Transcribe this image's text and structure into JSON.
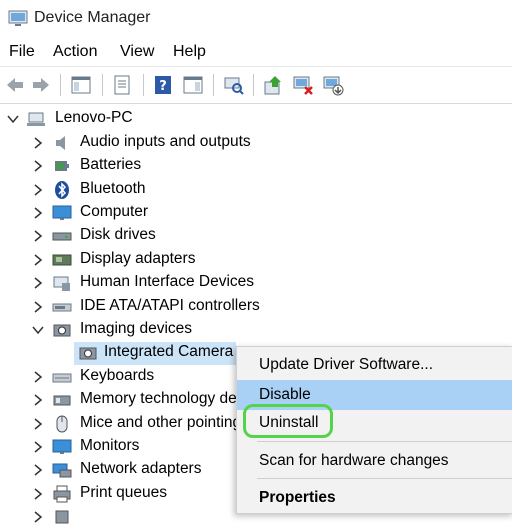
{
  "window": {
    "title": "Device Manager"
  },
  "menu": [
    "File",
    "Action",
    "View",
    "Help"
  ],
  "toolbar": {
    "icons": [
      "back-icon",
      "forward-icon",
      "show-hide-console-tree-icon",
      "properties-icon",
      "help-icon",
      "action-pane-icon",
      "scan-hardware-icon",
      "update-driver-icon",
      "disable-device-icon",
      "uninstall-device-icon"
    ]
  },
  "tree": {
    "root": "Lenovo-PC",
    "categories": [
      "Audio inputs and outputs",
      "Batteries",
      "Bluetooth",
      "Computer",
      "Disk drives",
      "Display adapters",
      "Human Interface Devices",
      "IDE ATA/ATAPI controllers",
      "Imaging devices",
      "Integrated Camera",
      "Keyboards",
      "Memory technology devices",
      "Mice and other pointing devices",
      "Monitors",
      "Network adapters",
      "Print queues"
    ]
  },
  "context_menu": {
    "items": [
      "Update Driver Software...",
      "Disable",
      "Uninstall",
      "Scan for hardware changes",
      "Properties"
    ],
    "highlighted": "Disable",
    "circled": "Uninstall",
    "highlight_color": "#a9d0f5",
    "circle_color": "#55d34a"
  }
}
